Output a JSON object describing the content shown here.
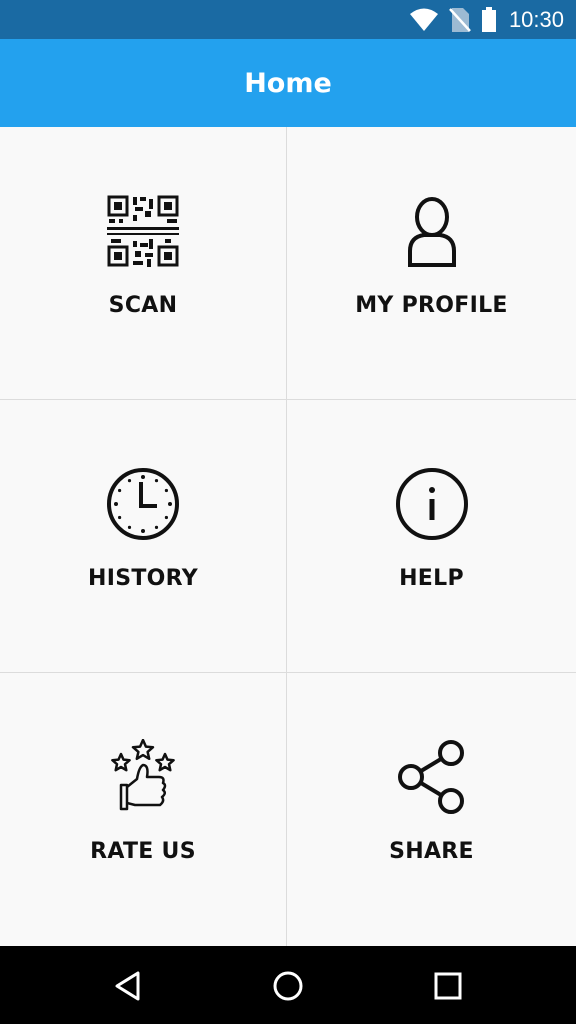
{
  "status_bar": {
    "time": "10:30",
    "icons": [
      "wifi-icon",
      "no-sim-icon",
      "battery-icon"
    ],
    "color": "#1a6aa3"
  },
  "app_bar": {
    "title": "Home",
    "color": "#23a1ee"
  },
  "tiles": [
    {
      "label": "SCAN",
      "icon": "qr-code-icon"
    },
    {
      "label": "MY PROFILE",
      "icon": "user-icon"
    },
    {
      "label": "HISTORY",
      "icon": "clock-icon"
    },
    {
      "label": "HELP",
      "icon": "info-icon"
    },
    {
      "label": "RATE US",
      "icon": "thumbs-up-stars-icon"
    },
    {
      "label": "SHARE",
      "icon": "share-icon"
    }
  ],
  "nav_bar": {
    "buttons": [
      "back-icon",
      "home-icon",
      "recents-icon"
    ]
  }
}
